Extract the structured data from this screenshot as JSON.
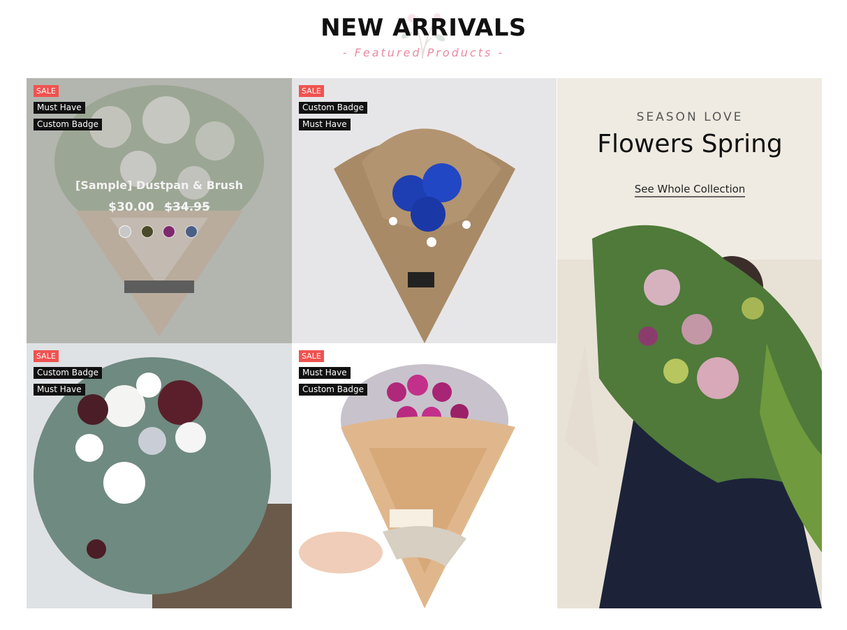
{
  "section": {
    "title": "NEW ARRIVALS",
    "subtitle": "- Featured Products -"
  },
  "products": [
    {
      "badges": [
        "SALE",
        "Must Have",
        "Custom Badge"
      ],
      "name": "[Sample] Dustpan & Brush",
      "price": "$30.00",
      "old_price": "$34.95",
      "swatches": [
        "#c8c8c8",
        "#4a4a2a",
        "#7d2a6e",
        "#4a5f86"
      ]
    },
    {
      "badges": [
        "SALE",
        "Custom Badge",
        "Must Have"
      ]
    },
    {
      "badges": [
        "SALE",
        "Custom Badge",
        "Must Have"
      ]
    },
    {
      "badges": [
        "SALE",
        "Must Have",
        "Custom Badge"
      ]
    }
  ],
  "promo": {
    "kicker": "SEASON LOVE",
    "title": "Flowers Spring",
    "link": "See Whole Collection"
  },
  "colors": {
    "sale_badge": "#ef5350",
    "badge": "#111111",
    "subtitle": "#e98aa3"
  }
}
